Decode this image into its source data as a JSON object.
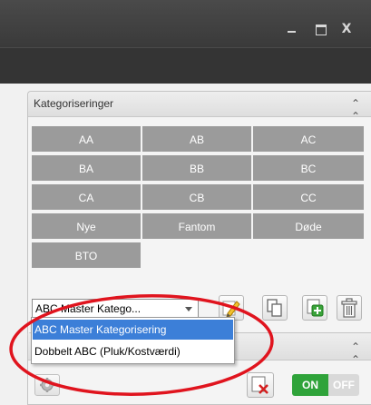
{
  "window": {
    "controls": {
      "minimize": "",
      "maximize": "",
      "close": "X"
    }
  },
  "panel": {
    "title": "Kategoriseringer",
    "collapse_icon": "double-chevron-up-icon",
    "categories": [
      "AA",
      "AB",
      "AC",
      "BA",
      "BB",
      "BC",
      "CA",
      "CB",
      "CC",
      "Nye",
      "Fantom",
      "Døde",
      "BTO"
    ]
  },
  "selector": {
    "selected_value": "ABC Master Katego...",
    "options": [
      "ABC Master Kategorisering",
      "Dobbelt ABC (Pluk/Kostværdi)"
    ]
  },
  "toolbar_icons": [
    "edit-icon",
    "copy-icon",
    "add-icon",
    "delete-icon"
  ],
  "panel2": {
    "collapse_icon": "double-chevron-up-icon",
    "settings_icon": "gear-icon",
    "clear_icon": "clear-filter-icon",
    "toggle": {
      "on_label": "ON",
      "off_label": "OFF"
    }
  },
  "colors": {
    "titlebar": "#3c3c3c",
    "category_tile": "#9b9b9b",
    "selected_option": "#3c7fd8",
    "toggle_on": "#2fa33a",
    "annotation": "#e0141e"
  }
}
